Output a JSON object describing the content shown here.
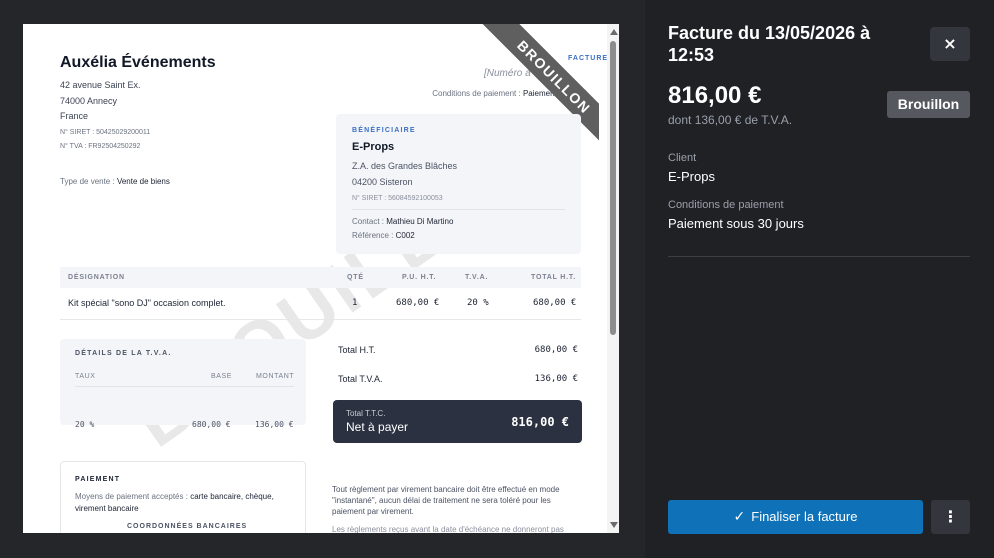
{
  "invoice": {
    "issuer": {
      "name": "Auxélia Événements",
      "address1": "42 avenue Saint Ex.",
      "address2": "74000 Annecy",
      "country": "France",
      "siret": "N° SIRET : 50425029200011",
      "tva": "N° TVA : FR92504250292"
    },
    "sale_type_label": "Type de vente :",
    "sale_type_value": "Vente de biens",
    "number_link": "FACTURE",
    "number_placeholder": "[Numéro à",
    "payment_terms_label": "Conditions de paiement :",
    "payment_terms_value": "Paiement sous 30",
    "watermark": "BROUILLON",
    "ribbon": "BROUILLON",
    "beneficiary": {
      "label": "BÉNÉFICIAIRE",
      "name": "E-Props",
      "address1": "Z.A. des Grandes Blâches",
      "address2": "04200 Sisteron",
      "siret": "N° SIRET : 56084592100053",
      "contact_label": "Contact :",
      "contact_value": "Mathieu Di Martino",
      "reference_label": "Référence :",
      "reference_value": "C002"
    },
    "items": {
      "headers": [
        "DÉSIGNATION",
        "QTÉ",
        "P.U. H.T.",
        "T.V.A.",
        "TOTAL H.T."
      ],
      "rows": [
        {
          "designation": "Kit spécial \"sono DJ\" occasion complet.",
          "qty": "1",
          "unit_price": "680,00 €",
          "vat": "20 %",
          "total": "680,00 €"
        }
      ]
    },
    "vat_details": {
      "title": "DÉTAILS DE LA T.V.A.",
      "headers": [
        "TAUX",
        "BASE",
        "MONTANT"
      ],
      "rows": [
        {
          "rate": "20 %",
          "base": "680,00 €",
          "amount": "136,00 €"
        }
      ]
    },
    "totals": {
      "ht_label": "Total H.T.",
      "ht_value": "680,00 €",
      "tva_label": "Total T.V.A.",
      "tva_value": "136,00 €",
      "ttc_label": "Total T.T.C.",
      "net_label": "Net à payer",
      "ttc_value": "816,00 €"
    },
    "payment": {
      "title": "PAIEMENT",
      "means_label": "Moyens de paiement acceptés :",
      "means_value": "carte bancaire, chèque, virement bancaire",
      "bank_title": "COORDONNÉES BANCAIRES"
    },
    "terms": "Tout règlement par virement bancaire doit être effectué en mode \"instantané\", aucun délai de traitement ne sera toléré pour les paiement par virement.",
    "terms2": "Les règlements reçus avant la date d'échéance ne donneront pas"
  },
  "panel": {
    "title": "Facture du 13/05/2026 à 12:53",
    "close_icon": "×",
    "amount": "816,00 €",
    "vat_note": "dont 136,00 € de T.V.A.",
    "status_badge": "Brouillon",
    "client_label": "Client",
    "client_value": "E-Props",
    "terms_label": "Conditions de paiement",
    "terms_value": "Paiement sous 30 jours",
    "finalize_label": "Finaliser la facture",
    "more_icon": "⋮",
    "colors": {
      "primary": "#0f72b9",
      "panel_bg": "#1f2125",
      "button_bg": "#33363c",
      "badge_bg": "#55585e"
    }
  }
}
